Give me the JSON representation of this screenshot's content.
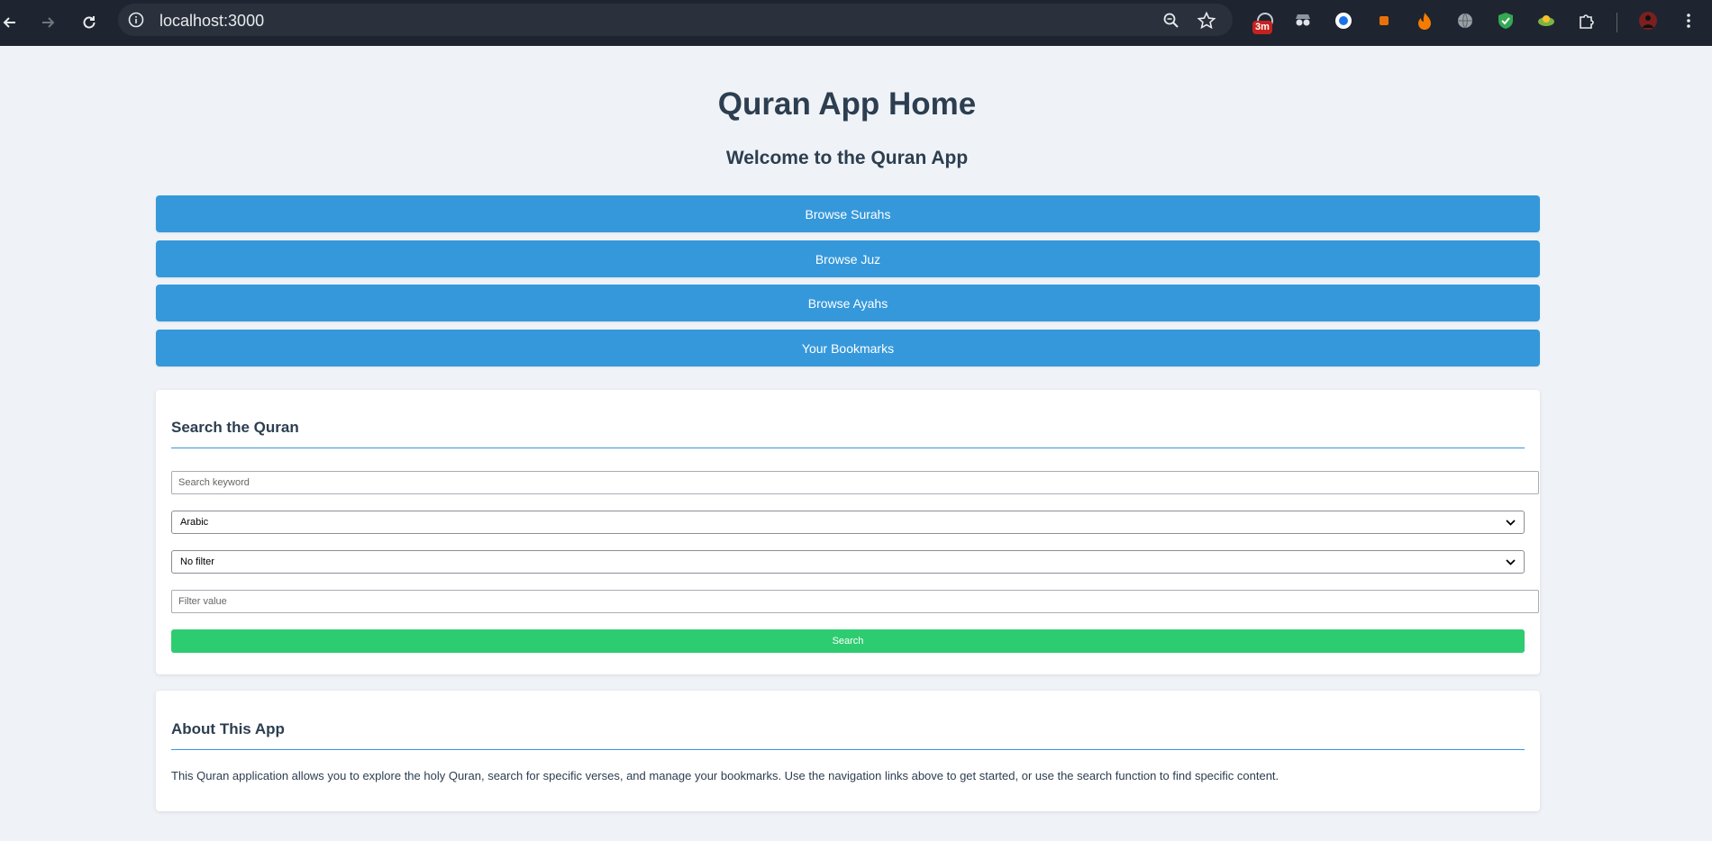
{
  "browser": {
    "url": "localhost:3000",
    "extension_badge": "3m"
  },
  "page": {
    "title": "Quran App Home",
    "subtitle": "Welcome to the Quran App"
  },
  "nav_links": {
    "browse_surahs": "Browse Surahs",
    "browse_juz": "Browse Juz",
    "browse_ayahs": "Browse Ayahs",
    "bookmarks": "Your Bookmarks"
  },
  "search": {
    "heading": "Search the Quran",
    "keyword_placeholder": "Search keyword",
    "language_selected": "Arabic",
    "filter_selected": "No filter",
    "filter_value_placeholder": "Filter value",
    "button_label": "Search"
  },
  "about": {
    "heading": "About This App",
    "text": "This Quran application allows you to explore the holy Quran, search for specific verses, and manage your bookmarks. Use the navigation links above to get started, or use the search function to find specific content."
  },
  "colors": {
    "primary": "#3598db",
    "success": "#2ecc71",
    "text": "#2c3e50",
    "background": "#eff3f7"
  }
}
